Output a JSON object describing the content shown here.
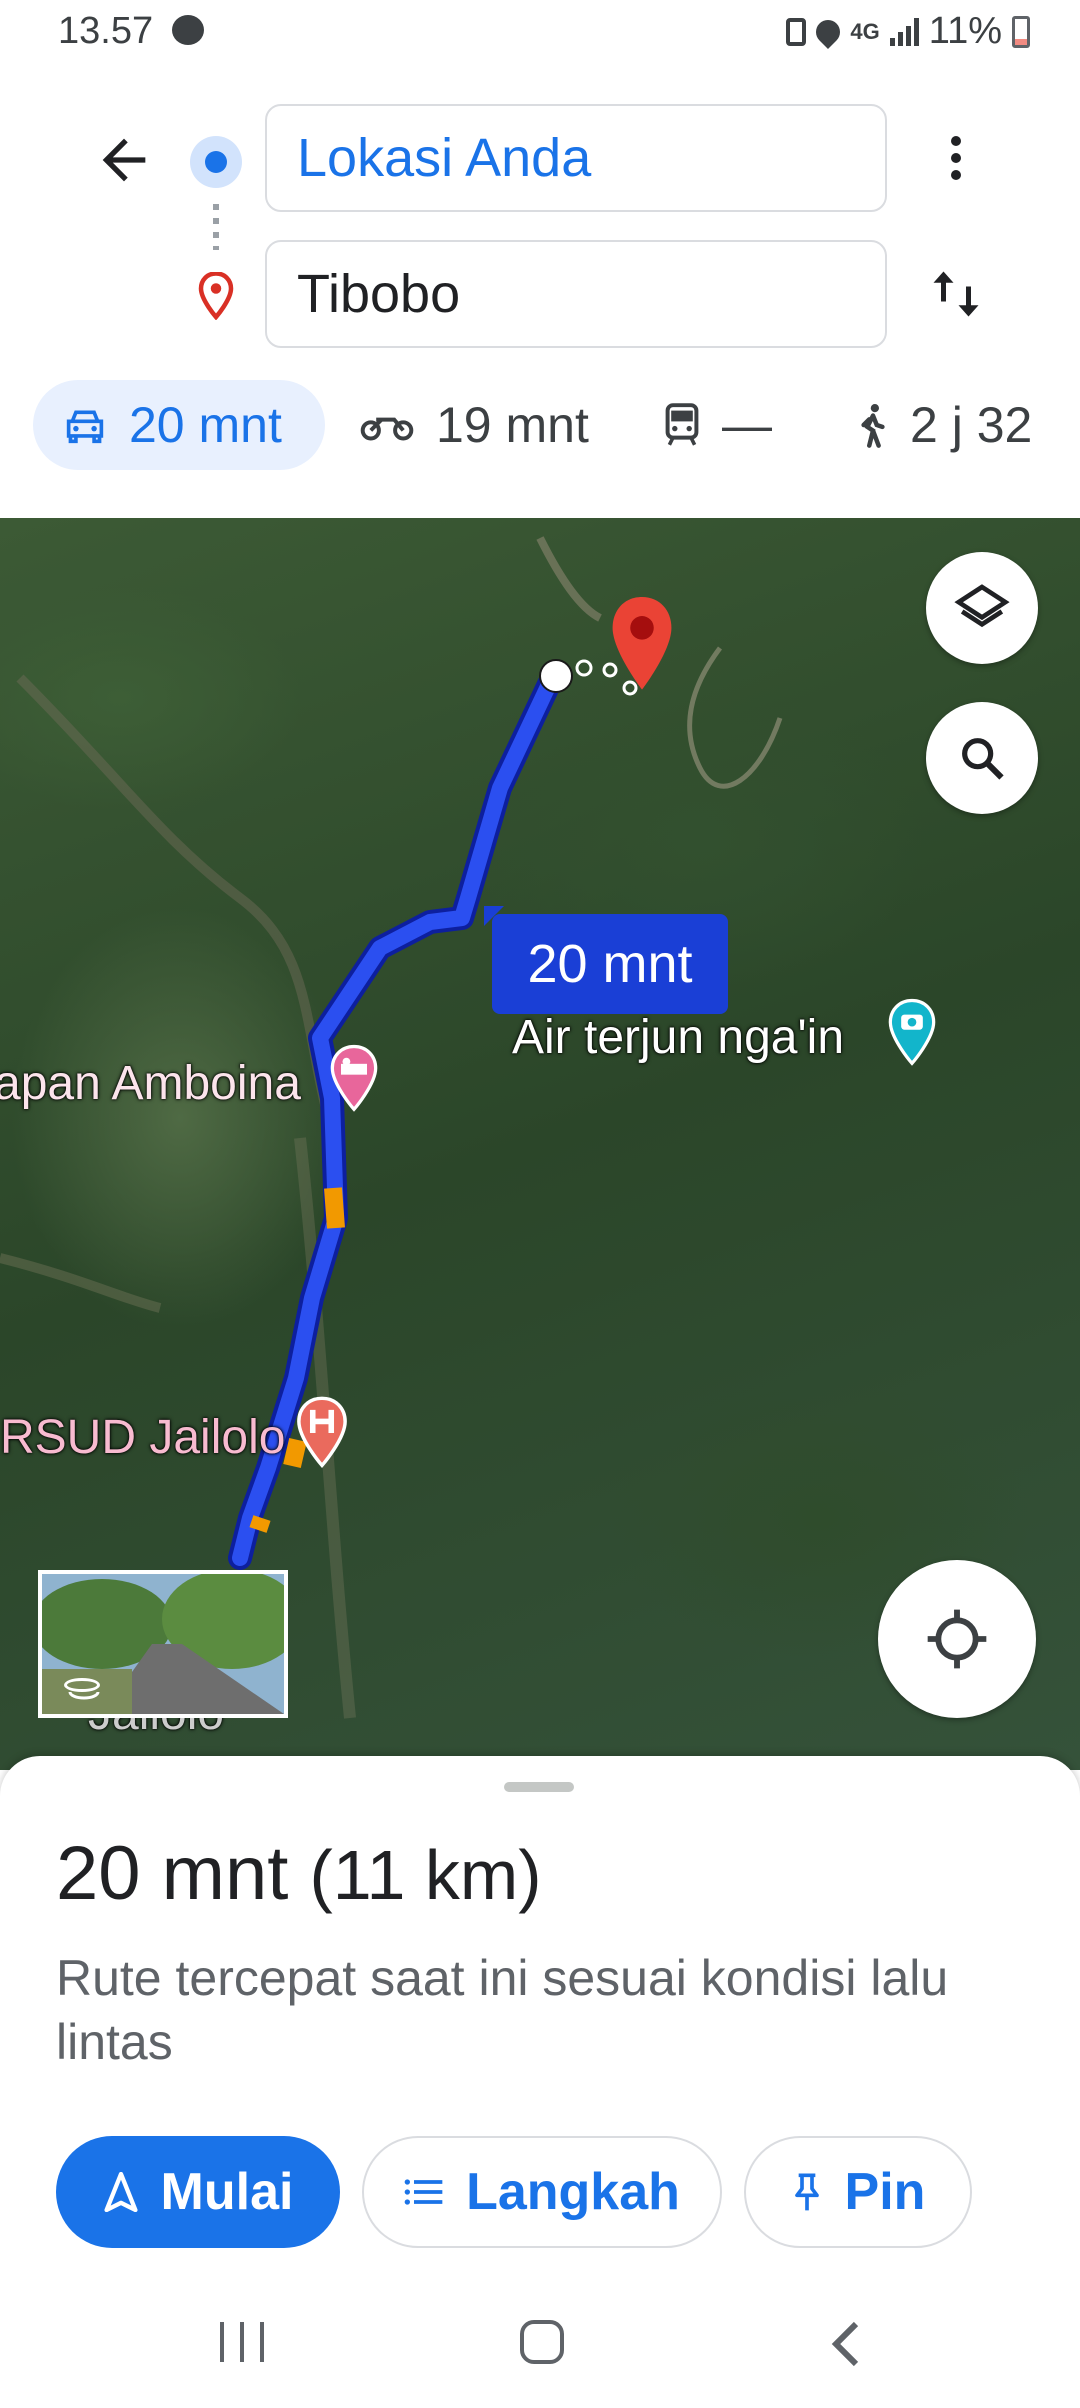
{
  "status": {
    "time": "13.57",
    "network": "4G",
    "battery": "11%"
  },
  "directions": {
    "origin": "Lokasi Anda",
    "destination": "Tibobo"
  },
  "modes": [
    {
      "name": "drive",
      "label": "20 mnt",
      "selected": true
    },
    {
      "name": "motorcycle",
      "label": "19 mnt",
      "selected": false
    },
    {
      "name": "transit",
      "label": "—",
      "selected": false
    },
    {
      "name": "walk",
      "label": "2 j 32",
      "selected": false
    }
  ],
  "map": {
    "route_time_bubble": "20 mnt",
    "places": {
      "amboina": "apan Amboina",
      "rsud": "RSUD Jailolo",
      "air_terjun": "Air terjun nga'in",
      "jailolo": "Jailolo"
    },
    "colors": {
      "route": "#1a3fd6",
      "traffic": "#f29900",
      "destination_pin": "#ea4335"
    }
  },
  "sheet": {
    "duration": "20 mnt",
    "distance": "(11 km)",
    "description": "Rute tercepat saat ini sesuai kondisi lalu lintas",
    "start_label": "Mulai",
    "steps_label": "Langkah",
    "pin_label": "Pin"
  },
  "accent_color": "#1a73e8"
}
